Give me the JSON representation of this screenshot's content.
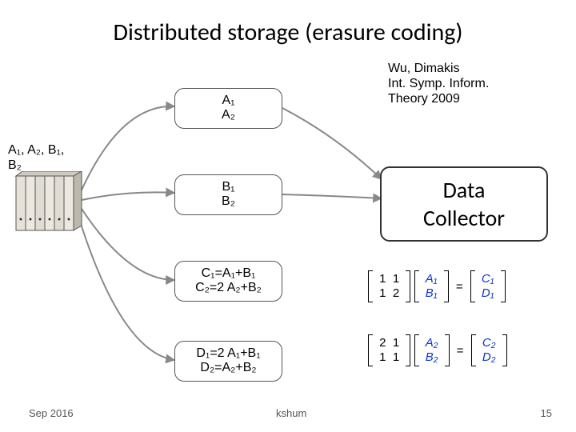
{
  "title": "Distributed storage (erasure coding)",
  "reference": {
    "line1": "Wu, Dimakis",
    "line2": " Int. Symp. Inform.",
    "line3": "Theory 2009"
  },
  "source_label": "A₁, A₂, B₁, B₂",
  "nodes": {
    "A": {
      "line1": "A₁",
      "line2": "A₂"
    },
    "B": {
      "line1": "B₁",
      "line2": "B₂"
    },
    "C": {
      "line1": "C₁=A₁+B₁",
      "line2": "C₂=2 A₂+B₂"
    },
    "D": {
      "line1": "D₁=2 A₁+B₁",
      "line2": "D₂=A₂+B₂"
    }
  },
  "collector": {
    "line1": "Data",
    "line2": "Collector"
  },
  "matrix1": {
    "m00": "1",
    "m01": "1",
    "m10": "1",
    "m11": "2",
    "v0": "A₁",
    "v1": "B₁",
    "r0": "C₁",
    "r1": "D₁"
  },
  "matrix2": {
    "m00": "2",
    "m01": "1",
    "m10": "1",
    "m11": "1",
    "v0": "A₂",
    "v1": "B₂",
    "r0": "C₂",
    "r1": "D₂"
  },
  "footer": {
    "left": "Sep 2016",
    "center": "kshum",
    "right": "15"
  },
  "icons": {
    "drive": "server-drives-icon"
  }
}
